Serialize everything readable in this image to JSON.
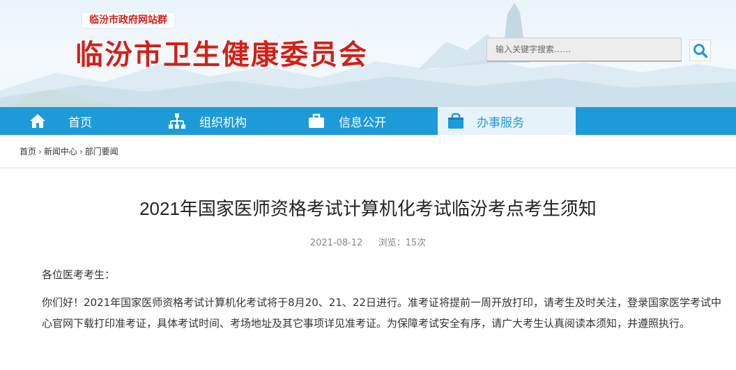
{
  "header": {
    "site_group": "临汾市政府网站群",
    "site_title": "临汾市卫生健康委员会",
    "search_placeholder": "输入关键字搜索……"
  },
  "nav": {
    "items": [
      {
        "label": "首页",
        "icon": "home-icon"
      },
      {
        "label": "组织机构",
        "icon": "org-chart-icon"
      },
      {
        "label": "信息公开",
        "icon": "briefcase-icon"
      },
      {
        "label": "办事服务",
        "icon": "shopping-bag-icon",
        "active": true
      }
    ]
  },
  "breadcrumb": {
    "items": [
      "首页",
      "新闻中心",
      "部门要闻"
    ],
    "separator": "›"
  },
  "article": {
    "title": "2021年国家医师资格考试计算机化考试临汾考点考生须知",
    "date": "2021-08-12",
    "views": "浏览：15次",
    "greeting": "各位医考考生：",
    "paragraph": "你们好！2021年国家医师资格考试计算机化考试将于8月20、21、22日进行。准考证将提前一周开放打印，请考生及时关注，登录国家医学考试中心官网下载打印准考证，具体考试时间、考场地址及其它事项详见准考证。为保障考试安全有序，请广大考生认真阅读本须知，并遵照执行。"
  },
  "colors": {
    "brand_red": "#d3201a",
    "nav_blue": "#1d9bd8",
    "nav_active_bg": "#e7f3fb"
  }
}
